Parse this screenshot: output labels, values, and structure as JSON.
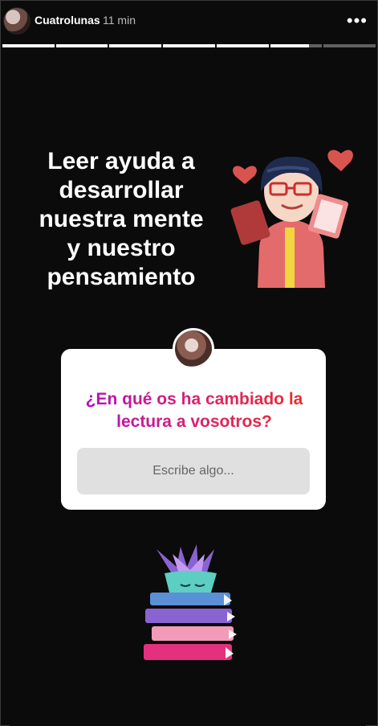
{
  "header": {
    "username": "Cuatrolunas",
    "time": "11 min",
    "more_glyph": "•••"
  },
  "progress": {
    "segments": [
      1,
      1,
      1,
      1,
      1,
      0.75,
      0
    ]
  },
  "story": {
    "headline": [
      "Leer ayuda a",
      "desarrollar",
      "nuestra mente",
      "y nuestro",
      "pensamiento"
    ],
    "question": "¿En qué os ha cambiado la lectura a vosotros?",
    "answer_placeholder": "Escribe algo..."
  },
  "icons": {
    "more": "more-options-icon",
    "reader": "reader-illustration",
    "books": "books-plant-illustration"
  },
  "colors": {
    "question_gradient_start": "#b10ec5",
    "question_gradient_end": "#ef2a2a"
  }
}
